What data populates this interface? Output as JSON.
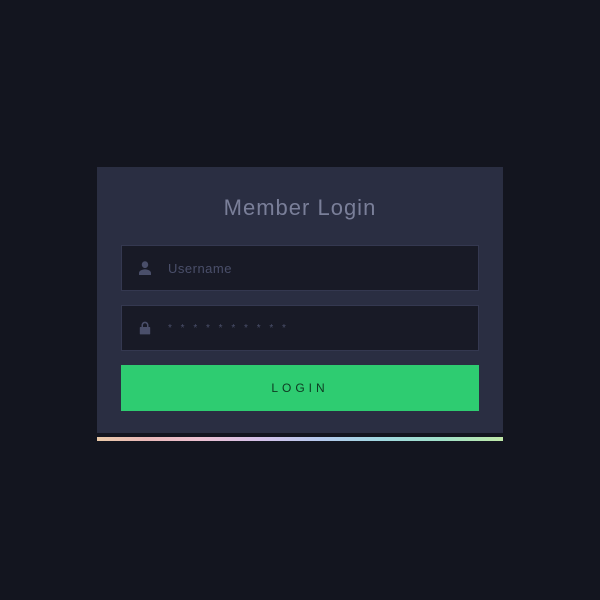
{
  "login": {
    "title": "Member Login",
    "username_placeholder": "Username",
    "password_masked": "* * * * * * * * * *",
    "button_label": "LOGIN"
  }
}
